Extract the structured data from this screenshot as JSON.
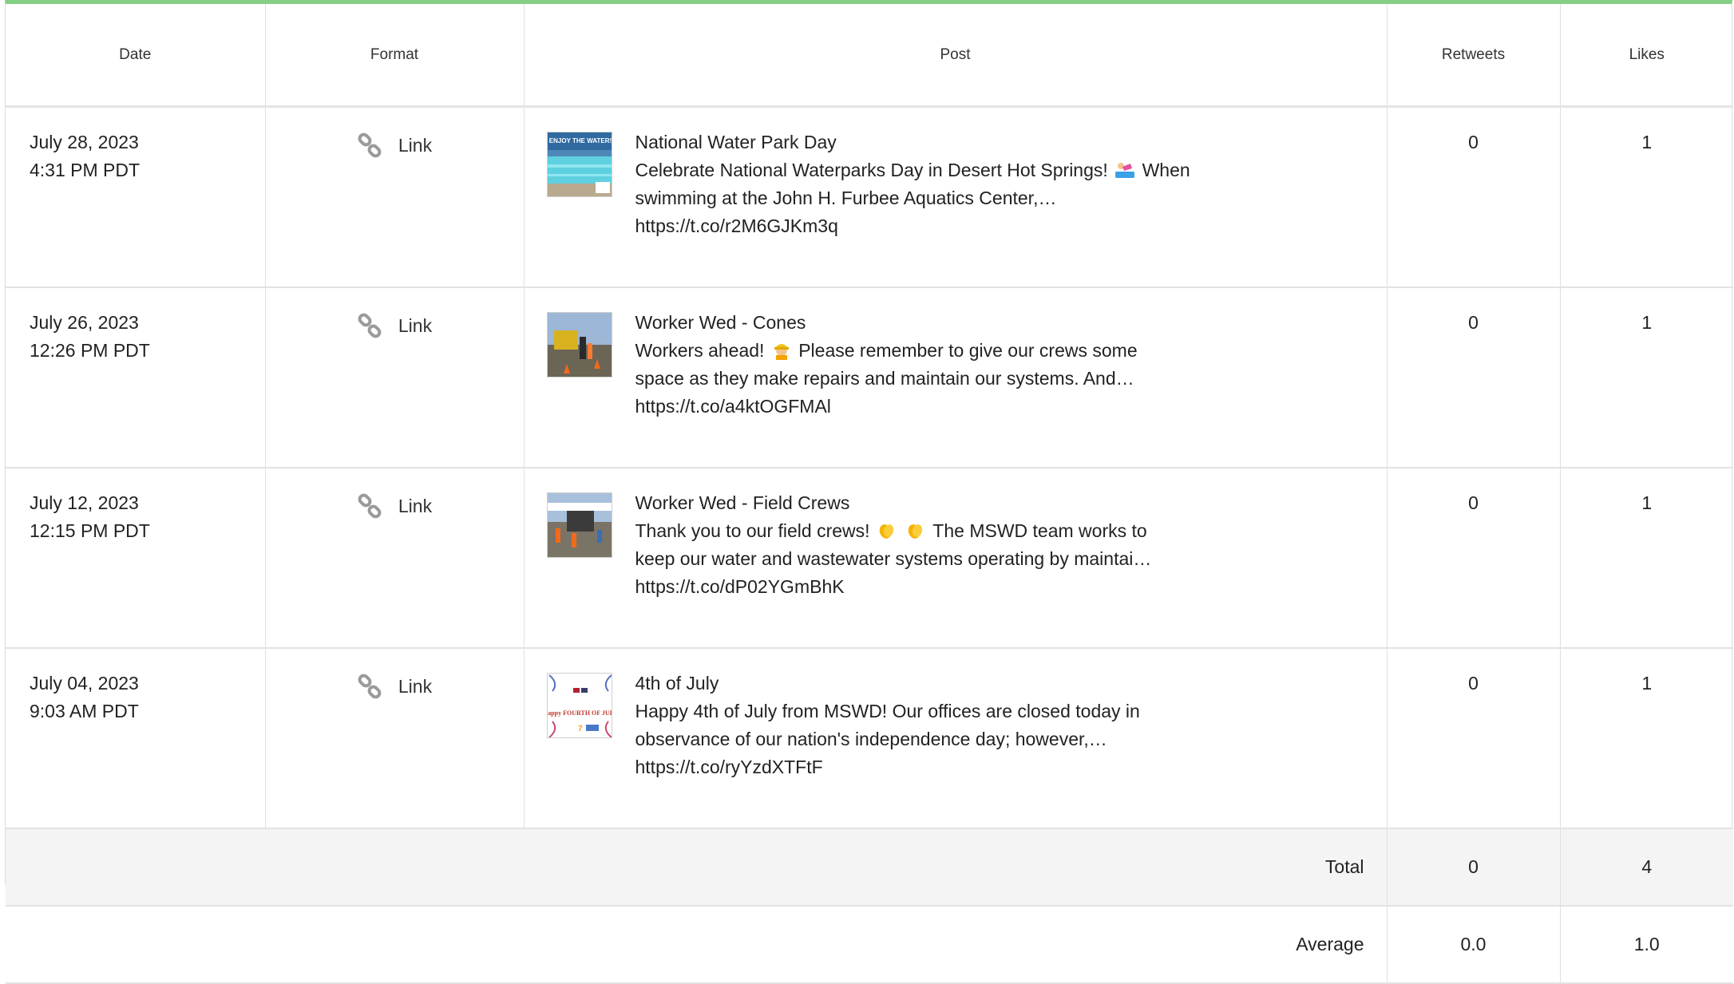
{
  "headers": {
    "date": "Date",
    "format": "Format",
    "post": "Post",
    "retweets": "Retweets",
    "likes": "Likes"
  },
  "rows": [
    {
      "date": "July 28, 2023",
      "time": "4:31 PM PDT",
      "format": "Link",
      "title": "National Water Park Day",
      "line1a": "Celebrate National Waterparks Day in Desert Hot Springs!",
      "line1b": "When",
      "line2": "swimming at the John H. Furbee Aquatics Center,…",
      "url": "https://t.co/r2M6GJKm3q",
      "retweets": "0",
      "likes": "1",
      "thumb_text": "ENJOY THE WATER!"
    },
    {
      "date": "July 26, 2023",
      "time": "12:26 PM PDT",
      "format": "Link",
      "title": "Worker Wed - Cones",
      "line1a": "Workers ahead!",
      "line1b": "Please remember to give our crews some",
      "line2": "space as they make repairs and maintain our systems. And…",
      "url": "https://t.co/a4ktOGFMAl",
      "retweets": "0",
      "likes": "1"
    },
    {
      "date": "July 12, 2023",
      "time": "12:15 PM PDT",
      "format": "Link",
      "title": "Worker Wed - Field Crews",
      "line1a": "Thank you to our field crews!",
      "line1b": "The MSWD team works to",
      "line2": "keep our water and wastewater systems operating by maintai…",
      "url": "https://t.co/dP02YGmBhK",
      "retweets": "0",
      "likes": "1"
    },
    {
      "date": "July 04, 2023",
      "time": "9:03 AM PDT",
      "format": "Link",
      "title": "4th of July",
      "line1a": "Happy 4th of July from MSWD! Our offices are closed today in",
      "line1b": "",
      "line2": "observance of our nation's independence day; however,…",
      "url": "https://t.co/ryYzdXTFtF",
      "retweets": "0",
      "likes": "1",
      "thumb_text": "Happy FOURTH OF JULY"
    }
  ],
  "footer": {
    "total_label": "Total",
    "total_retweets": "0",
    "total_likes": "4",
    "average_label": "Average",
    "average_retweets": "0.0",
    "average_likes": "1.0"
  },
  "colors": {
    "top_border": "#86cf86",
    "footer_bg": "#f4f4f4"
  },
  "icons": {
    "format": "link-icon",
    "swimmer": "swimmer-emoji",
    "worker": "construction-worker-emoji",
    "clap": "clapping-hands-emoji"
  }
}
